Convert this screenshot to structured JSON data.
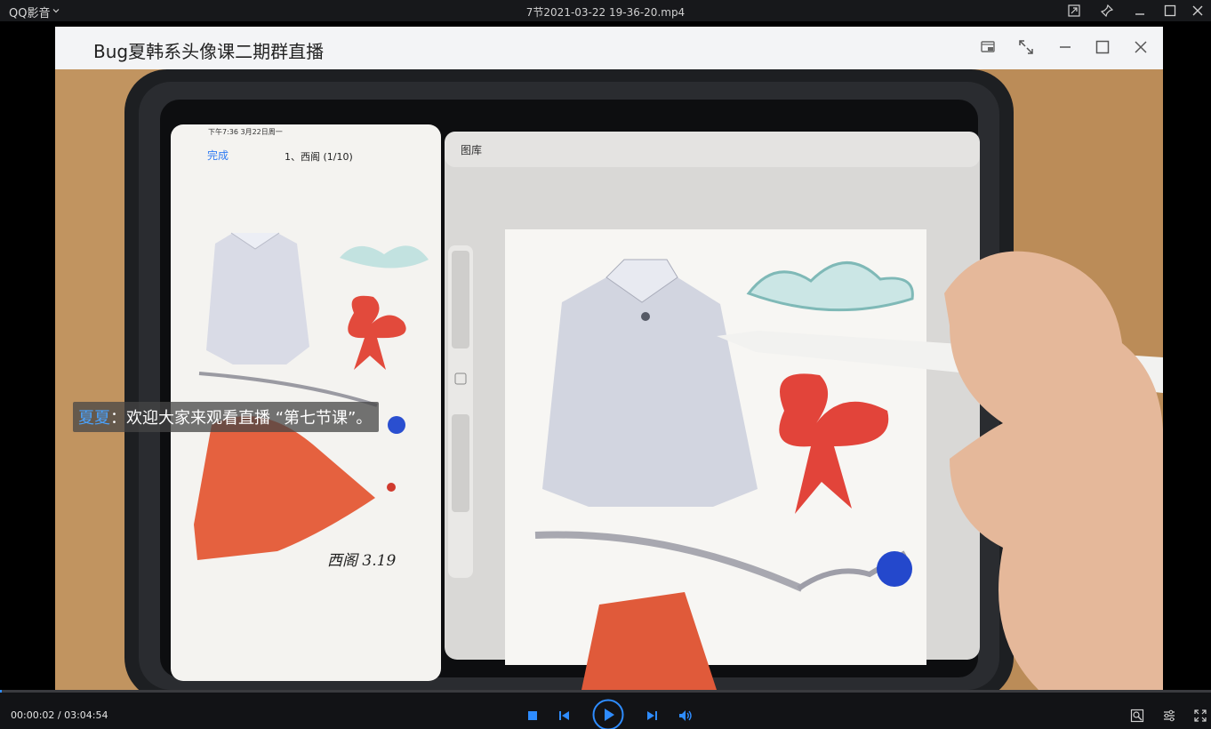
{
  "window": {
    "app_name": "QQ影音",
    "file_title": "7节2021-03-22 19-36-20.mp4"
  },
  "meeting": {
    "title": "Bug夏韩系头像课二期群直播"
  },
  "tablet": {
    "status_time": "下午7:36  3月22日周一",
    "done_label": "完成",
    "doc_title": "1、西阁 (1/10)",
    "gallery_label": "图库",
    "signature": "西阁 3.19"
  },
  "subtitle": {
    "speaker": "夏夏",
    "separator": "：",
    "text": "欢迎大家来观看直播 “第七节课”。"
  },
  "player": {
    "time_text": "00:00:02 / 03:04:54",
    "progress": 0.0002
  },
  "colors": {
    "accent": "#2e8cff",
    "speaker": "#4aa3ff"
  },
  "icons": [
    "chevron-down-icon",
    "mini-mode-icon",
    "pin-icon",
    "minimize-icon",
    "maximize-icon",
    "close-icon",
    "share-window-icon",
    "fullscreen-icon",
    "stop-icon",
    "previous-icon",
    "play-icon",
    "next-icon",
    "volume-icon",
    "screenshot-icon",
    "settings-icon",
    "fullscreen-toggle-icon"
  ]
}
